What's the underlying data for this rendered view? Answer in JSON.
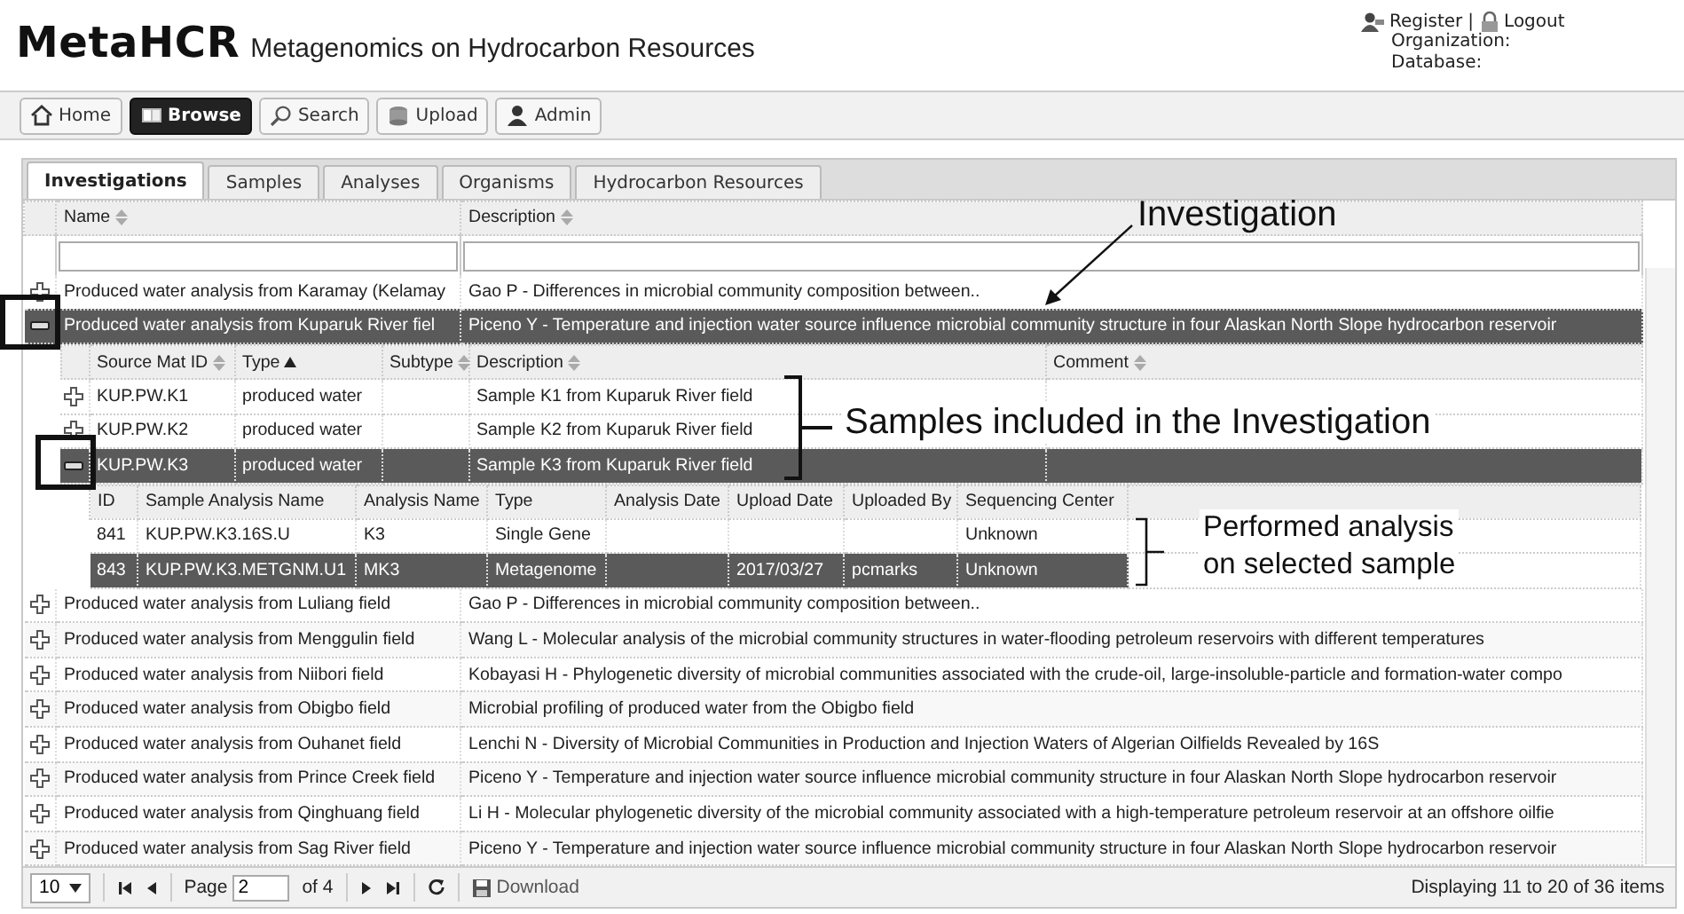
{
  "header": {
    "logo": "MetaHCR",
    "subtitle": "Metagenomics on Hydrocarbon Resources",
    "register": "Register",
    "separator": "|",
    "logout": "Logout",
    "organization": "Organization:",
    "database": "Database:"
  },
  "toolbar": [
    {
      "label": "Home",
      "selected": false
    },
    {
      "label": "Browse",
      "selected": true
    },
    {
      "label": "Search",
      "selected": false
    },
    {
      "label": "Upload",
      "selected": false
    },
    {
      "label": "Admin",
      "selected": false
    }
  ],
  "tabs": [
    {
      "label": "Investigations",
      "selected": true
    },
    {
      "label": "Samples",
      "selected": false
    },
    {
      "label": "Analyses",
      "selected": false
    },
    {
      "label": "Organisms",
      "selected": false
    },
    {
      "label": "Hydrocarbon Resources",
      "selected": false
    }
  ],
  "grid": {
    "columns": [
      {
        "label": "Name",
        "sorted": false
      },
      {
        "label": "Description",
        "sorted": false
      }
    ],
    "rows": [
      {
        "name": "Produced water analysis from Karamay (Kelamay",
        "description": "Gao P - Differences in microbial community composition between..",
        "expanded": false,
        "selected": false
      },
      {
        "name": "Produced water analysis from Kuparuk River fiel",
        "description": "Piceno Y - Temperature and injection water source influence microbial community structure in four Alaskan North Slope hydrocarbon reservoir",
        "expanded": true,
        "selected": true,
        "samples": {
          "columns": [
            {
              "label": "Source Mat ID",
              "sorted": false
            },
            {
              "label": "Type",
              "sorted": true
            },
            {
              "label": "Subtype",
              "sorted": false
            },
            {
              "label": "Description",
              "sorted": false
            },
            {
              "label": "Comment",
              "sorted": false
            }
          ],
          "rows": [
            {
              "source_mat_id": "KUP.PW.K1",
              "type": "produced water",
              "description": "Sample K1 from Kuparuk River field",
              "expanded": false,
              "selected": false
            },
            {
              "source_mat_id": "KUP.PW.K2",
              "type": "produced water",
              "description": "Sample K2 from Kuparuk River field",
              "expanded": false,
              "selected": false
            },
            {
              "source_mat_id": "KUP.PW.K3",
              "type": "produced water",
              "description": "Sample K3 from Kuparuk River field",
              "expanded": true,
              "selected": true,
              "analyses": {
                "columns": [
                  "ID",
                  "Sample Analysis Name",
                  "Analysis Name",
                  "Type",
                  "Analysis Date",
                  "Upload Date",
                  "Uploaded By",
                  "Sequencing Center"
                ],
                "rows": [
                  {
                    "id": "841",
                    "sample_analysis_name": "KUP.PW.K3.16S.U",
                    "analysis_name": "K3",
                    "type": "Single Gene",
                    "sequencing_center": "Unknown",
                    "selected": false
                  },
                  {
                    "id": "843",
                    "sample_analysis_name": "KUP.PW.K3.METGNM.U1",
                    "analysis_name": "MK3",
                    "type": "Metagenome",
                    "upload_date": "2017/03/27",
                    "uploaded_by": "pcmarks",
                    "sequencing_center": "Unknown",
                    "selected": true
                  }
                ]
              }
            }
          ]
        }
      },
      {
        "name": "Produced water analysis from Luliang field",
        "description": "Gao P - Differences in microbial community composition between..",
        "expanded": false,
        "selected": false
      },
      {
        "name": "Produced water analysis from Menggulin field",
        "description": "Wang L - Molecular analysis of the microbial community structures in water-flooding petroleum reservoirs with different temperatures",
        "expanded": false,
        "selected": false
      },
      {
        "name": "Produced water analysis from Niibori field",
        "description": "Kobayasi H - Phylogenetic diversity of microbial communities associated with the crude-oil, large-insoluble-particle and formation-water compo",
        "expanded": false,
        "selected": false
      },
      {
        "name": "Produced water analysis from Obigbo field",
        "description": "Microbial profiling of produced water from the Obigbo field",
        "expanded": false,
        "selected": false
      },
      {
        "name": "Produced water analysis from Ouhanet field",
        "description": "Lenchi N - Diversity of Microbial Communities in Production and Injection Waters of Algerian Oilfields Revealed by 16S",
        "expanded": false,
        "selected": false
      },
      {
        "name": "Produced water analysis from Prince Creek field",
        "description": "Piceno Y - Temperature and injection water source influence microbial community structure in four Alaskan North Slope hydrocarbon reservoir",
        "expanded": false,
        "selected": false
      },
      {
        "name": "Produced water analysis from Qinghuang field",
        "description": "Li H - Molecular phylogenetic diversity of the microbial community associated with a high-temperature petroleum reservoir at an offshore oilfie",
        "expanded": false,
        "selected": false
      },
      {
        "name": "Produced water analysis from Sag River field",
        "description": "Piceno Y - Temperature and injection water source influence microbial community structure in four Alaskan North Slope hydrocarbon reservoir",
        "expanded": false,
        "selected": false
      }
    ]
  },
  "pager": {
    "page_size": "10",
    "page_label": "Page",
    "page": "2",
    "of_label": "of 4",
    "download": "Download",
    "summary": "Displaying 11 to 20 of 36 items"
  },
  "annotations": [
    {
      "kind": "arrow",
      "text": "Investigation"
    },
    {
      "kind": "brace",
      "text": "Samples included in the Investigation"
    },
    {
      "kind": "brace-small",
      "lines": [
        "Performed analysis",
        "on selected sample"
      ]
    },
    {
      "kind": "frame"
    },
    {
      "kind": "frame"
    }
  ]
}
